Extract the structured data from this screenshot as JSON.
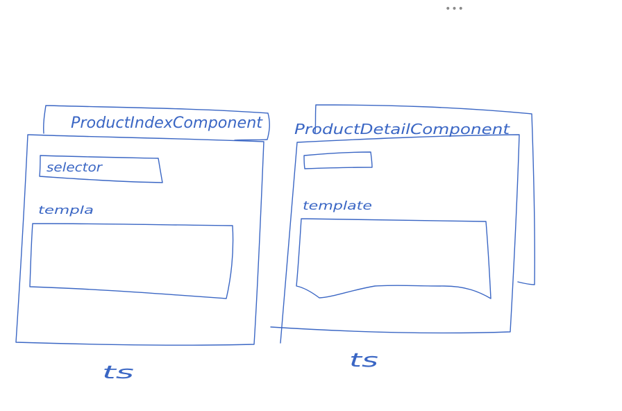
{
  "toolbar": {
    "more_label": "•••"
  },
  "sketch": {
    "left_component": {
      "title": "ProductIndexComponent",
      "selector_label": "selector",
      "template_label": "templa",
      "file_label": "ts"
    },
    "right_component": {
      "title": "ProductDetailComponent",
      "selector_label": "",
      "template_label": "template",
      "file_label": "ts"
    },
    "ink_color": "#3a66c4"
  }
}
